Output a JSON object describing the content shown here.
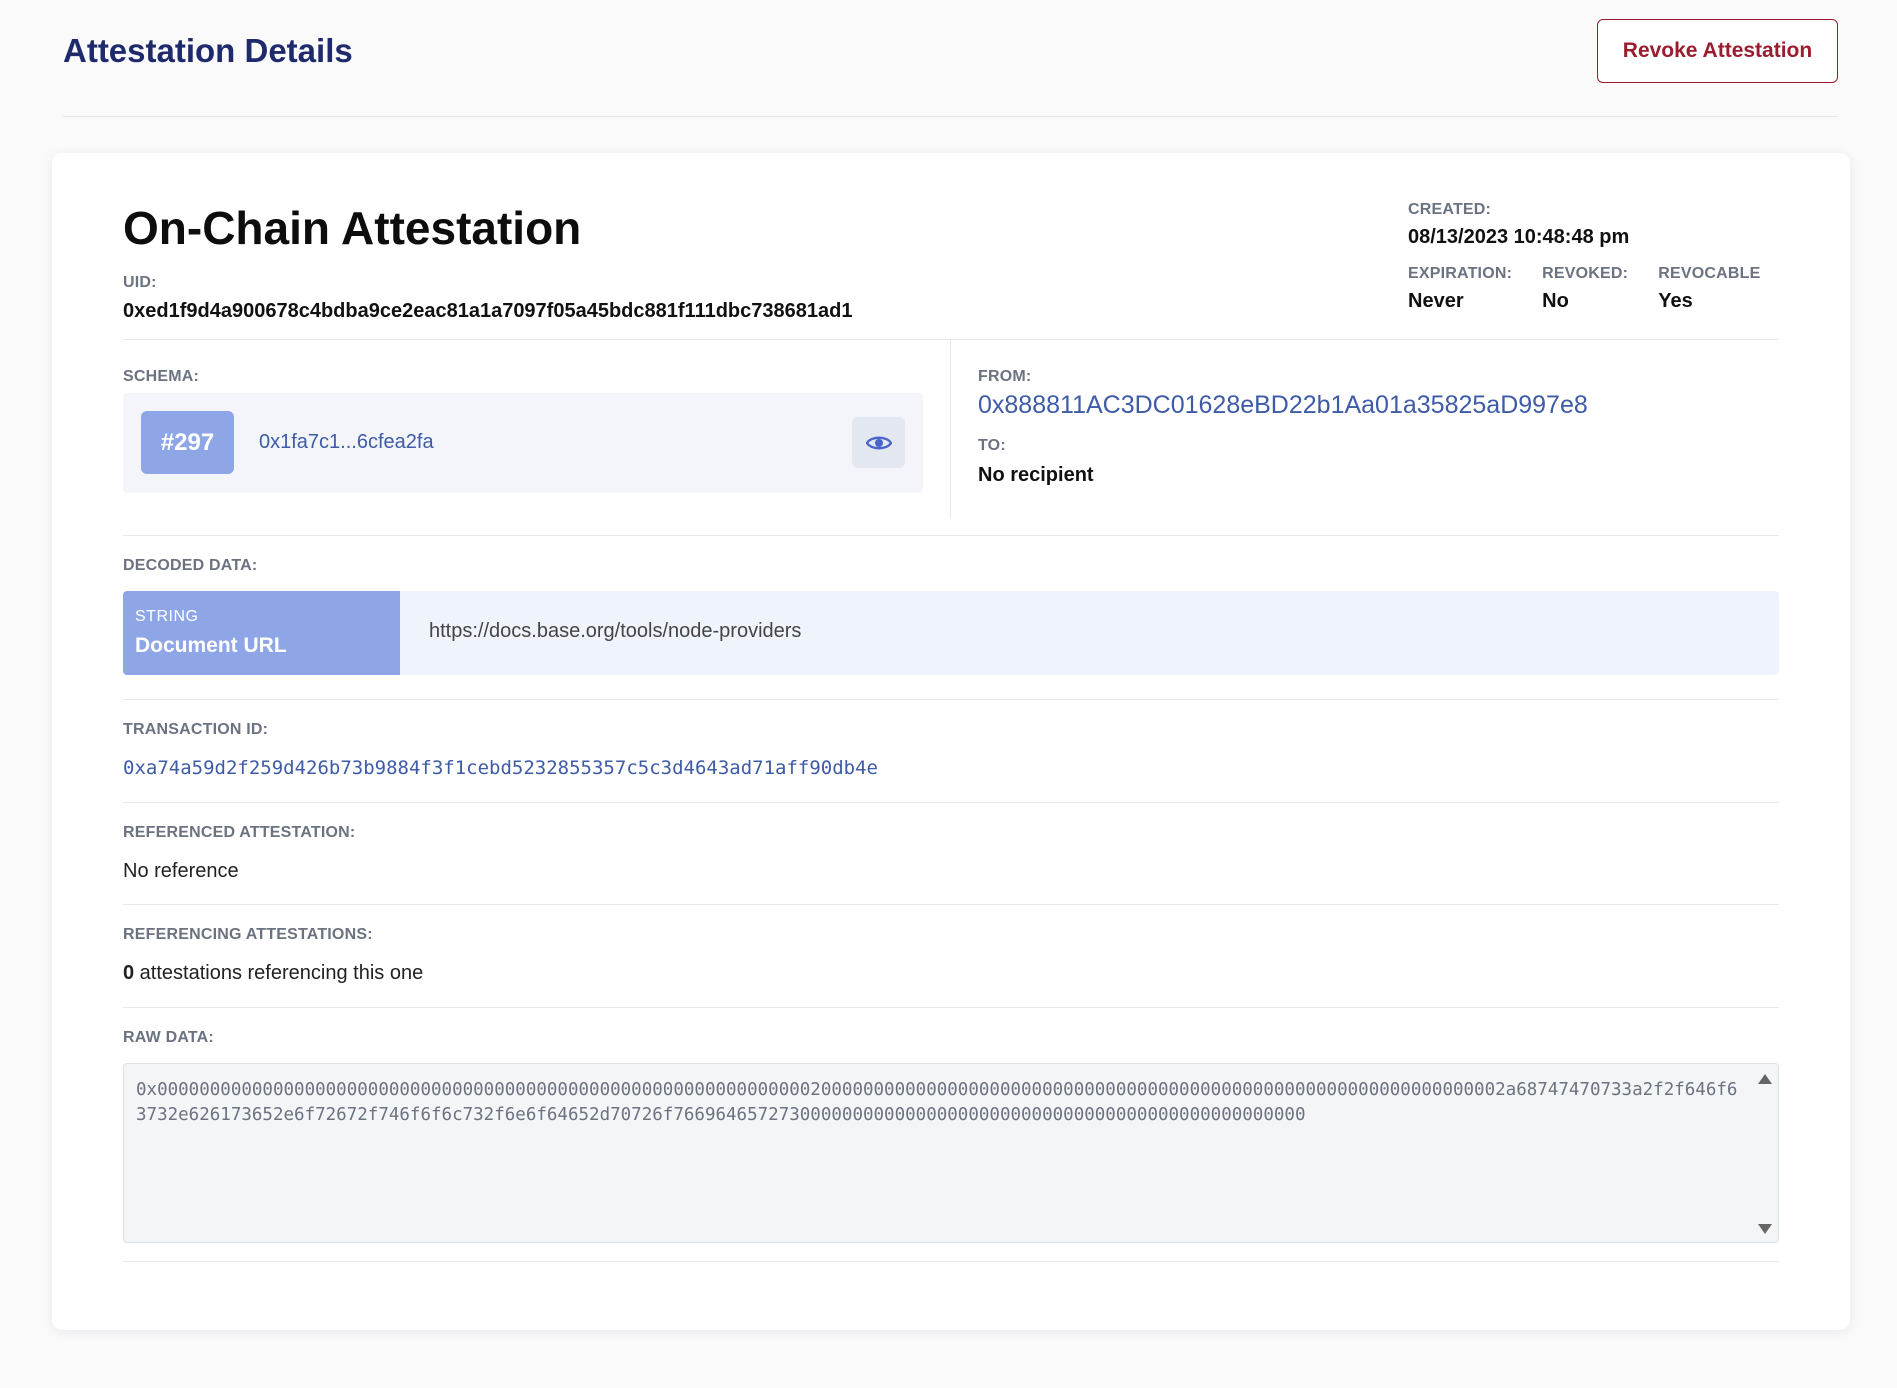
{
  "header": {
    "title": "Attestation Details",
    "revoke_label": "Revoke Attestation"
  },
  "attestation": {
    "title": "On-Chain Attestation",
    "uid_label": "UID:",
    "uid": "0xed1f9d4a900678c4bdba9ce2eac81a1a7097f05a45bdc881f111dbc738681ad1",
    "created_label": "CREATED:",
    "created": "08/13/2023 10:48:48 pm",
    "expiration_label": "EXPIRATION:",
    "expiration": "Never",
    "revoked_label": "REVOKED:",
    "revoked": "No",
    "revocable_label": "REVOCABLE",
    "revocable": "Yes"
  },
  "schema": {
    "label": "SCHEMA:",
    "badge": "#297",
    "uid": "0x1fa7c1...6cfea2fa"
  },
  "parties": {
    "from_label": "FROM:",
    "from": "0x888811AC3DC01628eBD22b1Aa01a35825aD997e8",
    "to_label": "TO:",
    "to": "No recipient"
  },
  "decoded": {
    "label": "DECODED DATA:",
    "type": "STRING",
    "name": "Document URL",
    "value": "https://docs.base.org/tools/node-providers"
  },
  "transaction": {
    "label": "TRANSACTION ID:",
    "id": "0xa74a59d2f259d426b73b9884f3f1cebd5232855357c5c3d4643ad71aff90db4e"
  },
  "referenced": {
    "label": "REFERENCED ATTESTATION:",
    "value": "No reference"
  },
  "referencing": {
    "label": "REFERENCING ATTESTATIONS:",
    "count": "0",
    "text": " attestations referencing this one"
  },
  "raw": {
    "label": "RAW DATA:",
    "value": "0x00000000000000000000000000000000000000000000000000000000000000200000000000000000000000000000000000000000000000000000000000000002a68747470733a2f2f646f63732e626173652e6f72672f746f6f6c732f6e6f64652d70726f766964657273000000000000000000000000000000000000000000000000"
  }
}
